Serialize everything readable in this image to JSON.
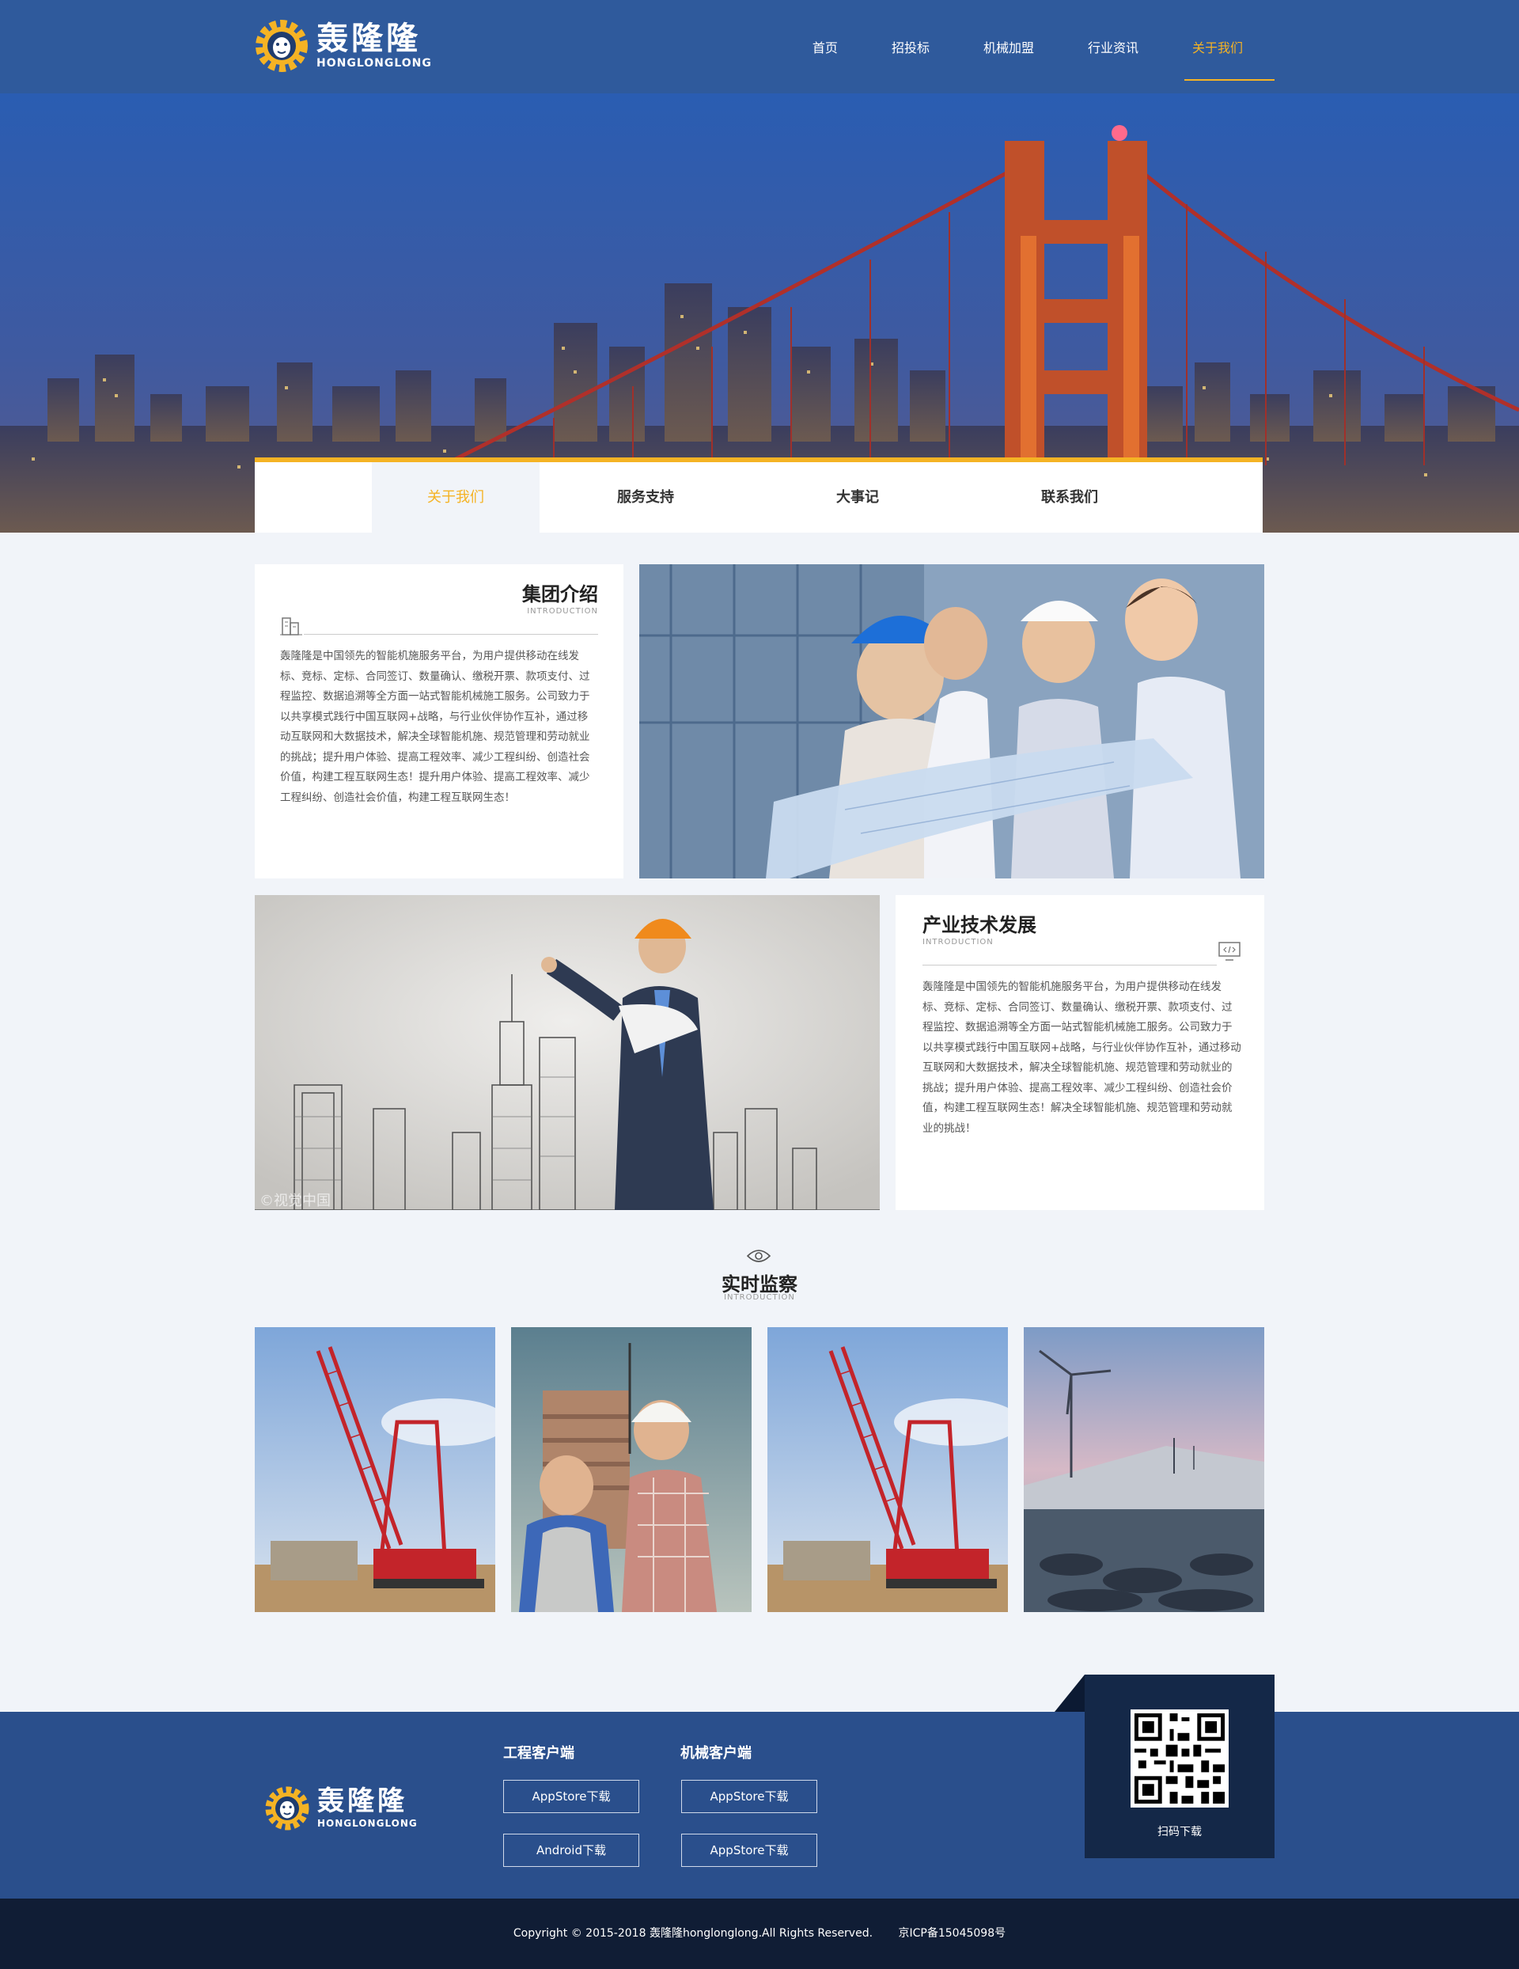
{
  "brand": {
    "name_cn": "轰隆隆",
    "name_en": "HONGLONGLONG"
  },
  "nav": {
    "items": [
      {
        "label": "首页"
      },
      {
        "label": "招投标"
      },
      {
        "label": "机械加盟"
      },
      {
        "label": "行业资讯"
      },
      {
        "label": "关于我们"
      }
    ],
    "active": "关于我们"
  },
  "subnav": {
    "items": [
      {
        "label": "关于我们"
      },
      {
        "label": "服务支持"
      },
      {
        "label": "大事记"
      },
      {
        "label": "联系我们"
      }
    ],
    "active": "关于我们"
  },
  "intro": {
    "title": "集团介绍",
    "subtitle": "INTRODUCTION",
    "body": "轰隆隆是中国领先的智能机施服务平台，为用户提供移动在线发标、竞标、定标、合同签订、数量确认、缴税开票、款项支付、过程监控、数据追溯等全方面一站式智能机械施工服务。公司致力于以共享模式践行中国互联网+战略，与行业伙伴协作互补，通过移动互联网和大数据技术，解决全球智能机施、规范管理和劳动就业的挑战；提升用户体验、提高工程效率、减少工程纠纷、创造社会价值，构建工程互联网生态！提升用户体验、提高工程效率、减少工程纠纷、创造社会价值，构建工程互联网生态！"
  },
  "tech": {
    "title": "产业技术发展",
    "subtitle": "INTRODUCTION",
    "body": "轰隆隆是中国领先的智能机施服务平台，为用户提供移动在线发标、竞标、定标、合同签订、数量确认、缴税开票、款项支付、过程监控、数据追溯等全方面一站式智能机械施工服务。公司致力于以共享模式践行中国互联网+战略，与行业伙伴协作互补，通过移动互联网和大数据技术，解决全球智能机施、规范管理和劳动就业的挑战；提升用户体验、提高工程效率、减少工程纠纷、创造社会价值，构建工程互联网生态！解决全球智能机施、规范管理和劳动就业的挑战！",
    "watermark": "©视觉中国"
  },
  "monitor": {
    "title": "实时监察",
    "subtitle": "INTRODUCTION"
  },
  "footer": {
    "engineering_client": {
      "title": "工程客户端",
      "buttons": [
        "AppStore下载",
        "Android下载"
      ]
    },
    "machine_client": {
      "title": "机械客户端",
      "buttons": [
        "AppStore下载",
        "AppStore下载"
      ]
    },
    "qr_label": "扫码下载",
    "copyright": "Copyright © 2015-2018 轰隆隆honglonglong.All Rights Reserved.",
    "icp": "京ICP备15045098号"
  },
  "colors": {
    "header_blue": "#2f5a9c",
    "accent_yellow": "#f5b324",
    "footer_blue": "#2a4f8c",
    "footer_dark": "#101d35",
    "page_bg": "#f1f4f9"
  }
}
